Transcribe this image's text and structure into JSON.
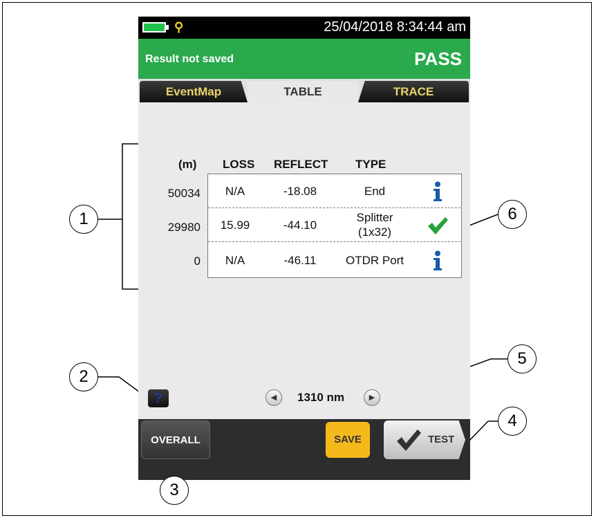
{
  "status_bar": {
    "datetime": "25/04/2018 8:34:44 am"
  },
  "header": {
    "save_status": "Result not saved",
    "verdict": "PASS"
  },
  "tabs": [
    {
      "label": "EventMap",
      "active": false
    },
    {
      "label": "TABLE",
      "active": true
    },
    {
      "label": "TRACE",
      "active": false
    }
  ],
  "table": {
    "headers": {
      "distance": "(m)",
      "loss": "LOSS",
      "reflect": "REFLECT",
      "type": "TYPE"
    },
    "rows": [
      {
        "distance": "50034",
        "loss": "N/A",
        "reflect": "-18.08",
        "type_line1": "End",
        "type_line2": "",
        "icon": "info-icon"
      },
      {
        "distance": "29980",
        "loss": "15.99",
        "reflect": "-44.10",
        "type_line1": "Splitter",
        "type_line2": "(1x32)",
        "icon": "check-icon"
      },
      {
        "distance": "0",
        "loss": "N/A",
        "reflect": "-46.11",
        "type_line1": "OTDR Port",
        "type_line2": "",
        "icon": "info-icon"
      }
    ]
  },
  "help_button": {
    "label": "?"
  },
  "wavelength": {
    "value": "1310 nm"
  },
  "bottom_bar": {
    "overall_label": "OVERALL",
    "save_label": "SAVE",
    "test_label": "TEST"
  },
  "callouts": [
    "1",
    "2",
    "3",
    "4",
    "5",
    "6"
  ],
  "colors": {
    "pass_green": "#2aa94d",
    "tab_text": "#e8d36a",
    "save_yellow": "#f6b91c",
    "info_blue": "#1a5aa8",
    "check_green": "#27a23a"
  }
}
